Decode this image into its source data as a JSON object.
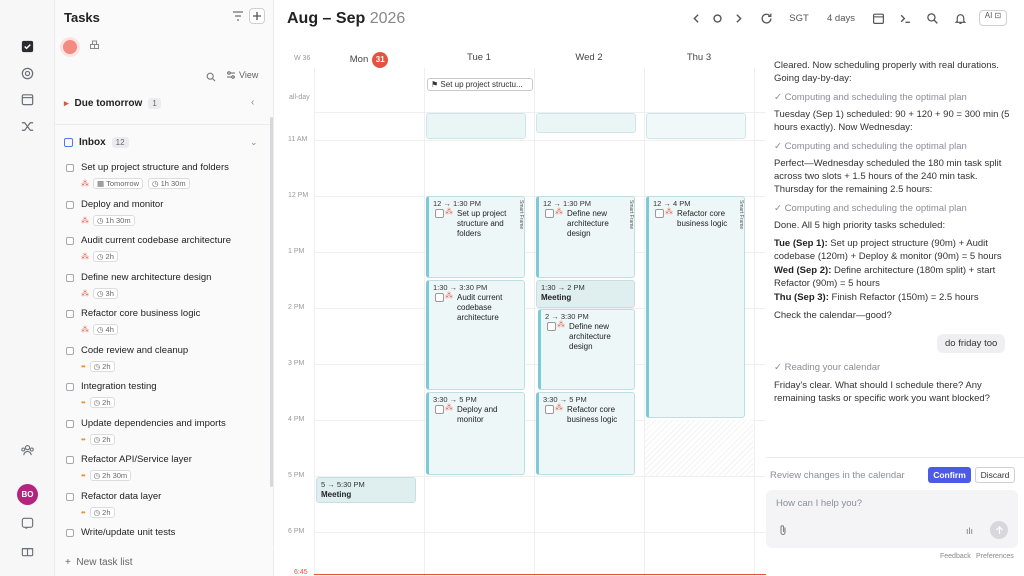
{
  "rail": {
    "avatar_initials": "BO"
  },
  "tasks_panel": {
    "title": "Tasks",
    "view_label": "View",
    "due_tomorrow": {
      "label": "Due tomorrow",
      "count": "1"
    },
    "inbox": {
      "label": "Inbox",
      "count": "12"
    },
    "items": [
      {
        "title": "Set up project structure and folders",
        "due": "Tomorrow",
        "duration": "1h 30m",
        "priority": "high"
      },
      {
        "title": "Deploy and monitor",
        "duration": "1h 30m",
        "priority": "high"
      },
      {
        "title": "Audit current codebase architecture",
        "duration": "2h",
        "priority": "high"
      },
      {
        "title": "Define new architecture design",
        "duration": "3h",
        "priority": "high"
      },
      {
        "title": "Refactor core business logic",
        "duration": "4h",
        "priority": "high"
      },
      {
        "title": "Code review and cleanup",
        "duration": "2h",
        "priority": "medium"
      },
      {
        "title": "Integration testing",
        "duration": "2h",
        "priority": "medium"
      },
      {
        "title": "Update dependencies and imports",
        "duration": "2h",
        "priority": "medium"
      },
      {
        "title": "Refactor API/Service layer",
        "duration": "2h 30m",
        "priority": "medium"
      },
      {
        "title": "Refactor data layer",
        "duration": "2h",
        "priority": "medium"
      },
      {
        "title": "Write/update unit tests",
        "duration": "",
        "priority": "medium"
      }
    ],
    "new_task_list": "New task list"
  },
  "calendar": {
    "title_bold": "Aug – Sep",
    "title_year": "2026",
    "timezone": "SGT",
    "range_label": "4 days",
    "ai_label": "AI",
    "week_label": "W 36",
    "allday_label": "all-day",
    "days": [
      {
        "name": "Mon",
        "date_badge": "31"
      },
      {
        "name": "Tue 1"
      },
      {
        "name": "Wed 2"
      },
      {
        "name": "Thu 3"
      }
    ],
    "hours": [
      "11 AM",
      "12 PM",
      "1 PM",
      "2 PM",
      "3 PM",
      "4 PM",
      "5 PM",
      "6 PM"
    ],
    "now_label": "6:45",
    "allday_event": "Set up project structu...",
    "events": [
      {
        "time": "12 → 1:30 PM",
        "name": "Set up project structure and folders",
        "side": "Smart Frame"
      },
      {
        "time": "12 → 1:30 PM",
        "name": "Define new architecture design",
        "side": "Smart Frame"
      },
      {
        "time": "12 → 4 PM",
        "name": "Refactor core business logic",
        "side": "Smart Frame"
      },
      {
        "time": "1:30 → 3:30 PM",
        "name": "Audit current codebase architecture"
      },
      {
        "time": "1:30 → 2 PM",
        "name": "Meeting"
      },
      {
        "time": "2 → 3:30 PM",
        "name": "Define new architecture design"
      },
      {
        "time": "3:30 → 5 PM",
        "name": "Deploy and monitor"
      },
      {
        "time": "3:30 → 5 PM",
        "name": "Refactor core business logic"
      },
      {
        "time": "5 → 5:30 PM",
        "name": "Meeting"
      }
    ]
  },
  "chat": {
    "messages": [
      {
        "kind": "text",
        "text": "Cleared. Now scheduling properly with real durations. Going day-by-day:"
      },
      {
        "kind": "status",
        "text": "✓ Computing and scheduling the optimal plan"
      },
      {
        "kind": "text",
        "text": "Tuesday (Sep 1) scheduled: 90 + 120 + 90 = 300 min (5 hours exactly). Now Wednesday:"
      },
      {
        "kind": "status",
        "text": "✓ Computing and scheduling the optimal plan"
      },
      {
        "kind": "text",
        "text": "Perfect—Wednesday scheduled the 180 min task split across two slots + 1.5 hours of the 240 min task. Thursday for the remaining 2.5 hours:"
      },
      {
        "kind": "status",
        "text": "✓ Computing and scheduling the optimal plan"
      },
      {
        "kind": "text",
        "text": "Done. All 5 high priority tasks scheduled:"
      },
      {
        "kind": "summary",
        "bold": "Tue (Sep 1):",
        "text": " Set up project structure (90m) + Audit codebase (120m) + Deploy & monitor (90m) = 5 hours"
      },
      {
        "kind": "summary",
        "bold": "Wed (Sep 2):",
        "text": " Define architecture (180m split) + start Refactor (90m) = 5 hours"
      },
      {
        "kind": "summary",
        "bold": "Thu (Sep 3):",
        "text": " Finish Refactor (150m) = 2.5 hours"
      },
      {
        "kind": "text",
        "text": "Check the calendar—good?"
      },
      {
        "kind": "user",
        "text": "do friday too"
      },
      {
        "kind": "status",
        "text": "✓ Reading your calendar"
      },
      {
        "kind": "text",
        "text": "Friday's clear. What should I schedule there? Any remaining tasks or specific work you want blocked?"
      }
    ],
    "review_text": "Review changes in the calendar",
    "confirm_label": "Confirm",
    "discard_label": "Discard",
    "input_placeholder": "How can I help you?",
    "footer_feedback": "Feedback",
    "footer_preferences": "Preferences"
  }
}
